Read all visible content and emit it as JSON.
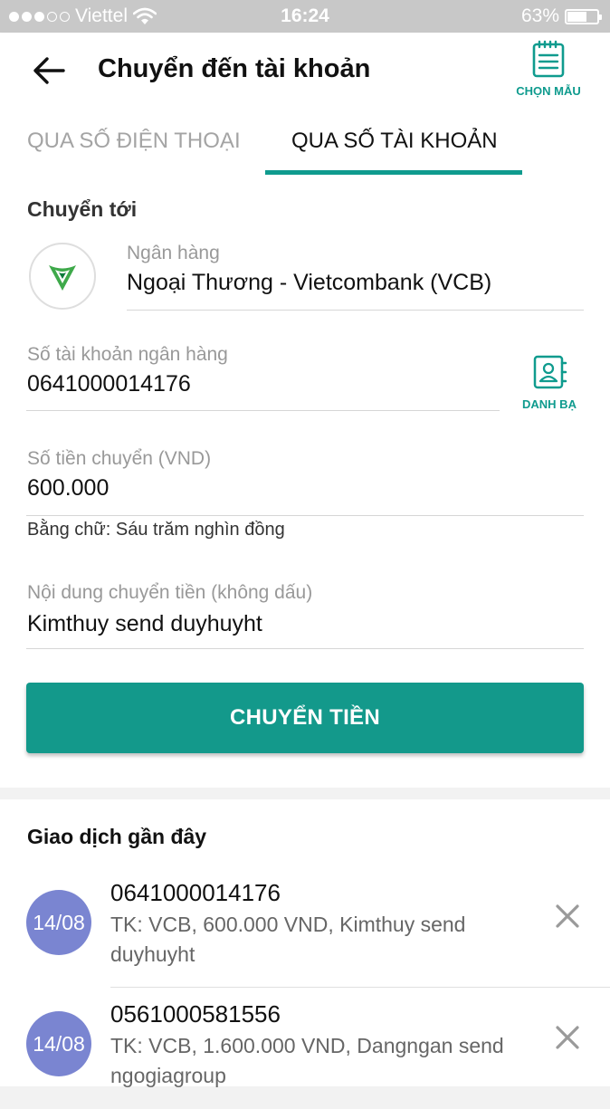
{
  "status_bar": {
    "carrier": "Viettel",
    "time": "16:24",
    "battery_text": "63%",
    "battery_level": 0.63,
    "signal_bars_filled": 3,
    "signal_bars_total": 5
  },
  "header": {
    "title": "Chuyển đến tài khoản",
    "template_label": "CHỌN MẪU"
  },
  "tabs": [
    {
      "label": "QUA SỐ ĐIỆN THOẠI",
      "active": false
    },
    {
      "label": "QUA SỐ TÀI KHOẢN",
      "active": true
    }
  ],
  "form": {
    "section_label": "Chuyển tới",
    "bank": {
      "label": "Ngân hàng",
      "value": "Ngoại Thương - Vietcombank (VCB)"
    },
    "account": {
      "label": "Số tài khoản ngân hàng",
      "value": "0641000014176",
      "contacts_label": "DANH BẠ"
    },
    "amount": {
      "label": "Số tiền chuyển (VND)",
      "value": "600.000",
      "in_words": "Bằng chữ: Sáu trăm nghìn đồng"
    },
    "content": {
      "label": "Nội dung chuyển tiền (không dấu)",
      "value": "Kimthuy send duyhuyht"
    },
    "submit_label": "CHUYỂN TIỀN"
  },
  "recent": {
    "title": "Giao dịch gần đây",
    "items": [
      {
        "date": "14/08",
        "account": "0641000014176",
        "description": "TK: VCB, 600.000 VND, Kimthuy send duyhuyht"
      },
      {
        "date": "14/08",
        "account": "0561000581556",
        "description": "TK: VCB, 1.600.000 VND, Dangngan send ngogiagroup"
      }
    ]
  },
  "colors": {
    "accent": "#0f9b8e",
    "button": "#13998b",
    "date_badge": "#7a85d1",
    "status_bar": "#c8c8c8"
  },
  "icons": {
    "back": "arrow-left-icon",
    "template": "notepad-icon",
    "contacts": "address-book-icon",
    "bank_logo": "vietcombank-logo",
    "delete": "close-x-icon"
  }
}
